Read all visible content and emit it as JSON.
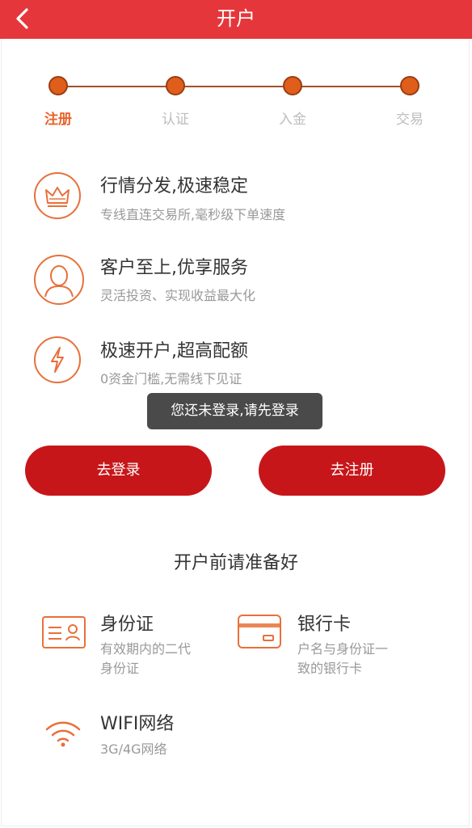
{
  "header": {
    "title": "开户"
  },
  "steps": [
    {
      "label": "注册",
      "active": true
    },
    {
      "label": "认证",
      "active": false
    },
    {
      "label": "入金",
      "active": false
    },
    {
      "label": "交易",
      "active": false
    }
  ],
  "features": [
    {
      "title": "行情分发,极速稳定",
      "desc": "专线直连交易所,毫秒级下单速度",
      "icon": "crown-icon"
    },
    {
      "title": "客户至上,优享服务",
      "desc": "灵活投资、实现收益最大化",
      "icon": "user-icon"
    },
    {
      "title": "极速开户,超高配额",
      "desc": "0资金门槛,无需线下见证",
      "icon": "lightning-icon"
    }
  ],
  "toast": {
    "text": "您还未登录,请先登录"
  },
  "buttons": {
    "login": "去登录",
    "register": "去注册"
  },
  "prepare": {
    "title": "开户前请准备好",
    "items": [
      {
        "name": "身份证",
        "desc_line1": "有效期内的二代",
        "desc_line2": "身份证",
        "icon": "id-card-icon"
      },
      {
        "name": "银行卡",
        "desc_line1": "户名与身份证一",
        "desc_line2": "致的银行卡",
        "icon": "bank-card-icon"
      },
      {
        "name": "WIFI网络",
        "desc_line1": "3G/4G网络",
        "icon": "wifi-icon"
      }
    ]
  },
  "colors": {
    "header": "#e5373b",
    "accent": "#e8622a",
    "button": "#c7161a"
  }
}
